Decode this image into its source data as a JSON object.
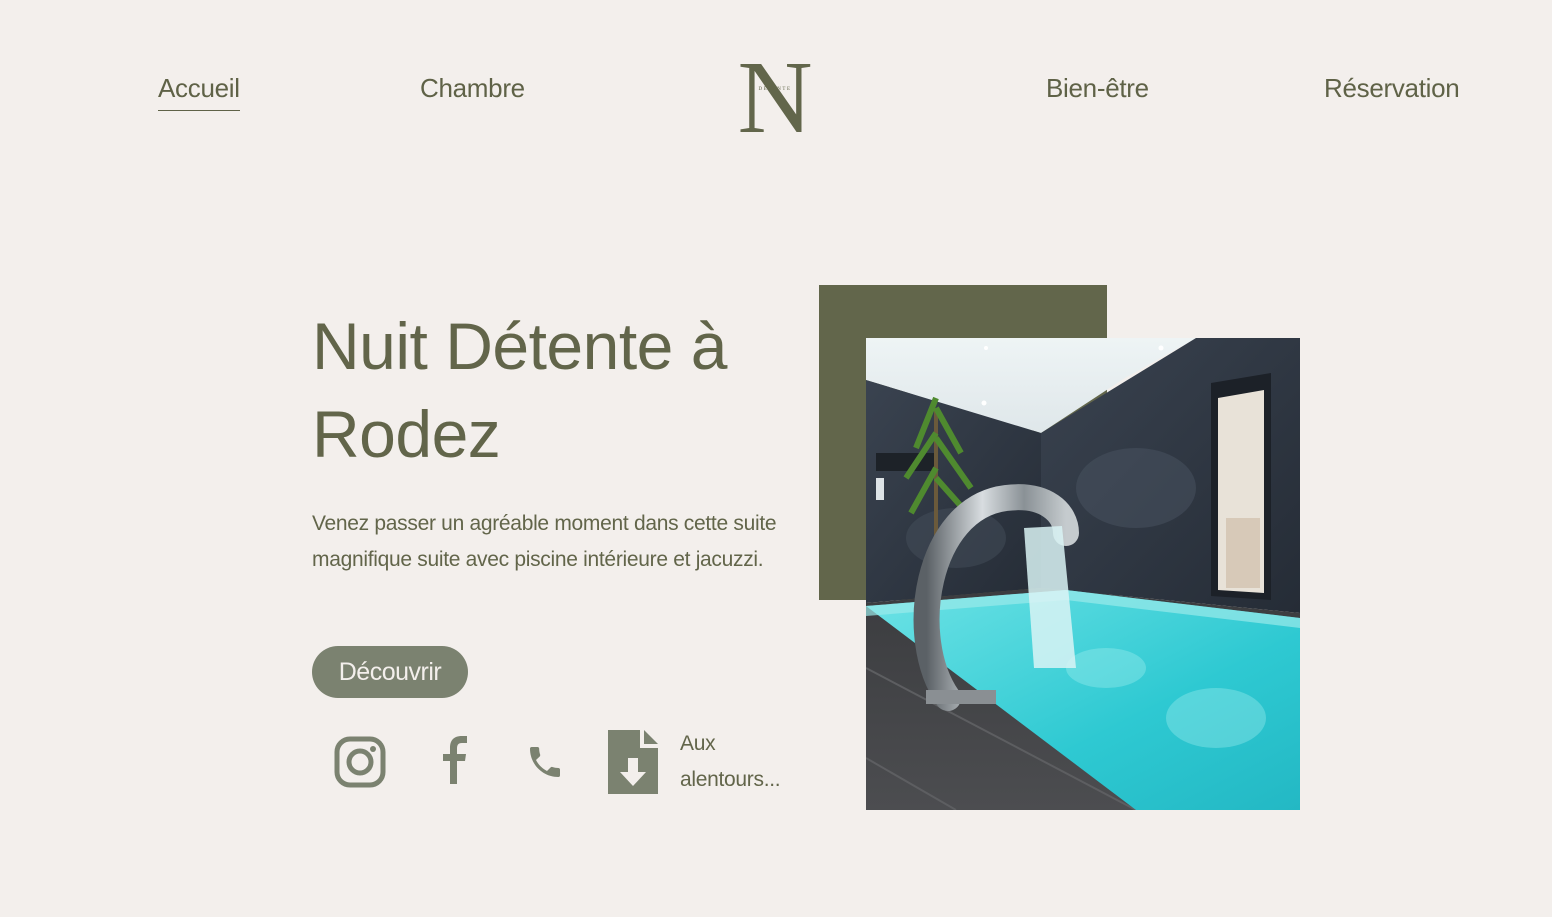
{
  "nav": {
    "items": [
      {
        "label": "Accueil",
        "active": true
      },
      {
        "label": "Chambre",
        "active": false
      },
      {
        "label": "Bien-être",
        "active": false
      },
      {
        "label": "Réservation",
        "active": false
      }
    ]
  },
  "logo": {
    "letter": "N",
    "tagline": "DÉTENTE"
  },
  "hero": {
    "title": "Nuit Détente à Rodez",
    "description": "Venez passer un agréable moment dans cette suite magnifique suite avec piscine intérieure et jacuzzi.",
    "cta_label": "Découvrir"
  },
  "social": {
    "icons": [
      "instagram-icon",
      "facebook-icon",
      "phone-icon",
      "file-download-icon"
    ],
    "download_label": "Aux alentours..."
  },
  "colors": {
    "background": "#f3efec",
    "accent": "#62664b",
    "button": "#7b8270",
    "pool": "#3fd0d6"
  }
}
